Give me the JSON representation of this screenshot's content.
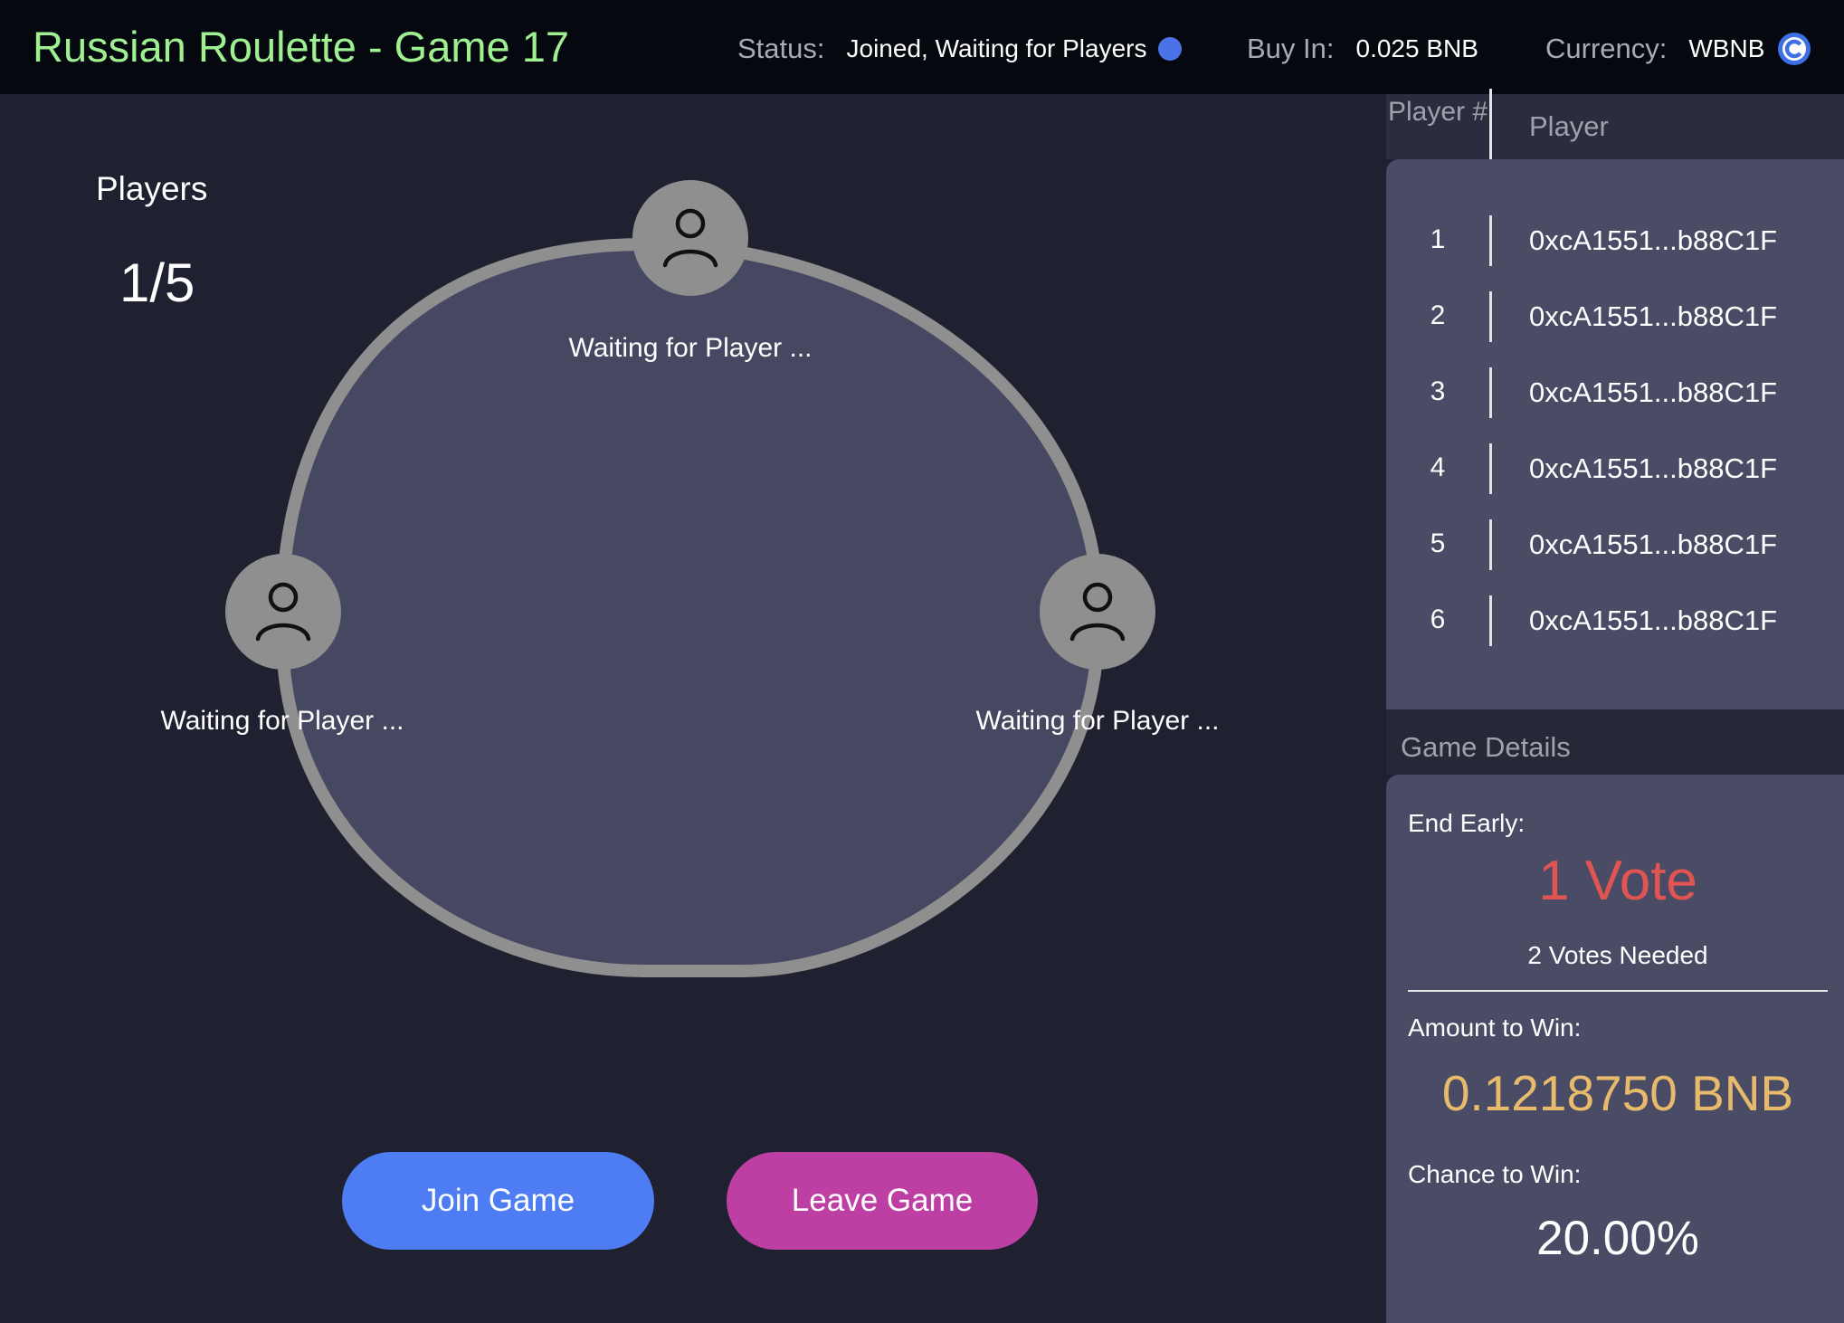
{
  "header": {
    "title": "Russian Roulette - Game 17",
    "status_label": "Status:",
    "status_value": "Joined, Waiting for Players",
    "status_dot_color": "#4c72e8",
    "buyin_label": "Buy In:",
    "buyin_value": "0.025 BNB",
    "currency_label": "Currency:",
    "currency_value": "WBNB",
    "currency_icon": "currency-coin-icon"
  },
  "players": {
    "label": "Players",
    "count": "1/5"
  },
  "seats": [
    {
      "label": "Waiting for Player ...",
      "icon": "user-avatar-icon"
    },
    {
      "label": "Waiting for Player ...",
      "icon": "user-avatar-icon"
    },
    {
      "label": "Waiting for Player ...",
      "icon": "user-avatar-icon"
    }
  ],
  "actions": {
    "join_label": "Join Game",
    "leave_label": "Leave Game"
  },
  "player_list": {
    "col_number": "Player #",
    "col_player": "Player",
    "rows": [
      {
        "num": "1",
        "address": "0xcA1551...b88C1F"
      },
      {
        "num": "2",
        "address": "0xcA1551...b88C1F"
      },
      {
        "num": "3",
        "address": "0xcA1551...b88C1F"
      },
      {
        "num": "4",
        "address": "0xcA1551...b88C1F"
      },
      {
        "num": "5",
        "address": "0xcA1551...b88C1F"
      },
      {
        "num": "6",
        "address": "0xcA1551...b88C1F"
      }
    ]
  },
  "game_details": {
    "title": "Game Details",
    "end_early_label": "End Early:",
    "votes_value": "1 Vote",
    "votes_needed": "2 Votes Needed",
    "amount_label": "Amount to Win:",
    "amount_value": "0.1218750 BNB",
    "chance_label": "Chance to Win:",
    "chance_value": "20.00%"
  },
  "colors": {
    "title_green": "#9ff091",
    "join_blue": "#4d7cf3",
    "leave_magenta": "#bd3fa3",
    "vote_red": "#e05552",
    "amount_gold": "#e8bb6c"
  }
}
